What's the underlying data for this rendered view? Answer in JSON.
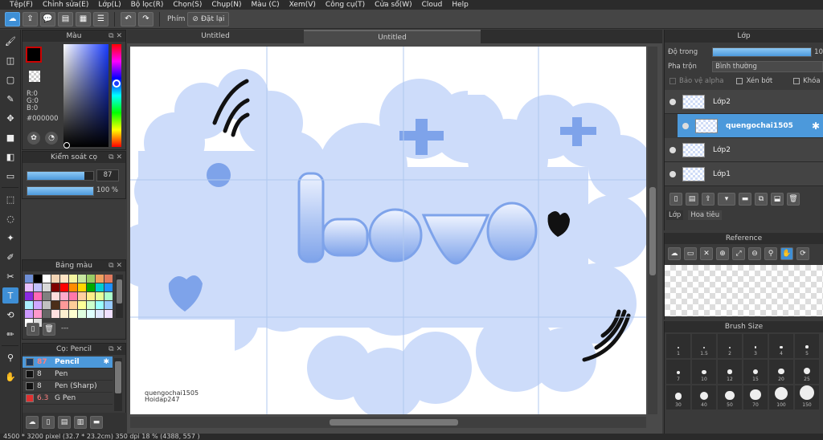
{
  "menu": [
    "Tệp(F)",
    "Chỉnh sửa(E)",
    "Lớp(L)",
    "Bộ lọc(R)",
    "Chọn(S)",
    "Chụp(N)",
    "Màu (C)",
    "Xem(V)",
    "Công cụ(T)",
    "Cửa sổ(W)",
    "Cloud",
    "Help"
  ],
  "toolbar": {
    "hotkey_label": "Phím",
    "reset_label": "Đặt lại"
  },
  "tabs": [
    "Untitled",
    "Untitled"
  ],
  "color_panel": {
    "title": "Màu",
    "r": "R:0",
    "g": "G:0",
    "b": "B:0",
    "hex": "#000000",
    "fg": "#000000"
  },
  "brush_control": {
    "title": "Kiểm soát cọ",
    "size": "87",
    "opacity": "100 %",
    "size_fraction": 0.87,
    "opacity_fraction": 1.0
  },
  "palette": {
    "title": "Bảng màu",
    "dash": "---",
    "colors": [
      "#6f8fd6",
      "#000000",
      "#ffffff",
      "#f2d4b4",
      "#ffe4c4",
      "#f5f5a0",
      "#c7e6a0",
      "#99cc66",
      "#f0a060",
      "#e07a5f",
      "#e8c0ff",
      "#c0c0ff",
      "#d9d9d9",
      "#7f0000",
      "#ff0000",
      "#ff8c00",
      "#ffd700",
      "#00aa00",
      "#00ced1",
      "#1e90ff",
      "#8a2be2",
      "#ff69b4",
      "#808080",
      "#ffdddd",
      "#ffaacc",
      "#ff77aa",
      "#ffd0a0",
      "#ffee88",
      "#e5ff99",
      "#aaffcc",
      "#aaeeff",
      "#cfa8ff",
      "#c0c0c0",
      "#4b2e19",
      "#ff9999",
      "#ffcc99",
      "#ffff99",
      "#ccffcc",
      "#99ffff",
      "#99ccff",
      "#cc99ff",
      "#ff99cc",
      "#666666",
      "#ffe0e0",
      "#fff0d0",
      "#ffffd0",
      "#e0ffe0",
      "#e0ffff",
      "#e0e8ff",
      "#f0e0ff",
      "#ffffff",
      "#dddddd"
    ]
  },
  "brush_list": {
    "title": "Cọ: Pencil",
    "items": [
      {
        "size": "87",
        "name": "Pencil",
        "color": "#1a3a60",
        "selected": true
      },
      {
        "size": "8",
        "name": "Pen",
        "color": "#111111",
        "selected": false
      },
      {
        "size": "8",
        "name": "Pen (Sharp)",
        "color": "#111111",
        "selected": false
      },
      {
        "size": "6.3",
        "name": "G Pen",
        "color": "#e03030",
        "selected": false
      }
    ]
  },
  "layers": {
    "title": "Lớp",
    "opacity_label": "Độ trong",
    "opacity_value": "10",
    "blend_label": "Pha trộn",
    "blend_value": "Bình thường",
    "protect_alpha": "Bảo vệ alpha",
    "clipping": "Xén bớt",
    "lock": "Khóa",
    "items": [
      {
        "name": "Lớp2",
        "selected": false
      },
      {
        "name": "quengochai1505",
        "selected": true
      },
      {
        "name": "Lớp2",
        "selected": false
      },
      {
        "name": "Lớp1",
        "selected": false
      }
    ],
    "bottom_tabs": [
      "Lớp",
      "Hoa tiêu"
    ]
  },
  "reference": {
    "title": "Reference"
  },
  "brush_size": {
    "title": "Brush Size",
    "labels": [
      "1",
      "1.5",
      "2",
      "3",
      "4",
      "5",
      "7",
      "10",
      "12",
      "15",
      "20",
      "25",
      "30",
      "40",
      "50",
      "70",
      "100",
      "150"
    ]
  },
  "canvas_text": {
    "word": "love",
    "signature_line1": "quengochai1505",
    "signature_line2": "Hoidap247"
  },
  "status": "4500 * 3200 pixel   (32.7 * 23.2cm)   350 dpi   18 %   (4388, 557 )"
}
